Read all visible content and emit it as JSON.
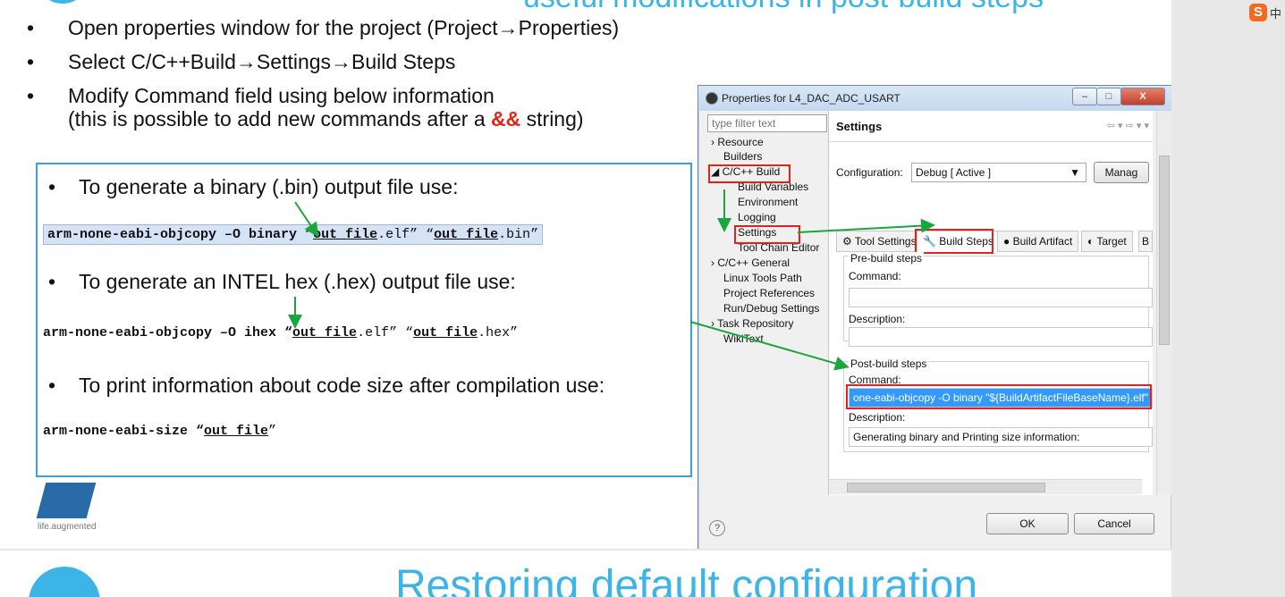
{
  "header": {
    "title_cut": "useful modifications in post-build steps"
  },
  "bullets": [
    {
      "text": "Open properties window for the project (Project→Properties)"
    },
    {
      "text": "Select C/C++Build→Settings→Build Steps"
    },
    {
      "text_line1": "Modify Command field using below information",
      "text_line2_pre": "(this is possible to add new commands after a ",
      "amp": "&&",
      "text_line2_post": " string)"
    }
  ],
  "codebox": {
    "item1": "To generate a binary (.bin) output file use:",
    "code1": {
      "a": "arm-none-eabi-objcopy –O binary “",
      "b": "out_file",
      "c": ".elf” “",
      "d": "out_file",
      "e": ".bin”"
    },
    "item2": "To generate an INTEL hex (.hex) output file use:",
    "code2": {
      "a": "arm-none-eabi-objcopy –O ihex “",
      "b": "out_file",
      "c": ".elf” “",
      "d": "out_file",
      "e": ".hex”"
    },
    "item3": "To print information about code size after compilation use:",
    "code3": {
      "a": "arm-none-eabi-size “",
      "b": "out_file",
      "c": "”"
    }
  },
  "logo": {
    "tagline": "life.augmented"
  },
  "window": {
    "title": "Properties for L4_DAC_ADC_USART",
    "controls": {
      "minimize": "–",
      "maximize": "□",
      "close": "X"
    },
    "filter_placeholder": "type filter text",
    "tree": [
      "› Resource",
      "Builders",
      "◢ C/C++ Build",
      "Build Variables",
      "Environment",
      "Logging",
      "Settings",
      "Tool Chain Editor",
      "› C/C++ General",
      "Linux Tools Path",
      "Project References",
      "Run/Debug Settings",
      "› Task Repository",
      "WikiText"
    ],
    "panel": {
      "title": "Settings",
      "nav": "⇦ ▾ ⇨ ▾ ▾",
      "config_label": "Configuration:",
      "config_value": "Debug  [ Active ]",
      "manage": "Manag",
      "tabs": [
        "Tool Settings",
        "Build Steps",
        "Build Artifact",
        "Target",
        "B"
      ],
      "pre_build": "Pre-build steps",
      "command": "Command:",
      "description": "Description:",
      "post_build": "Post-build steps",
      "post_command_value": "one-eabi-objcopy -O binary \"${BuildArtifactFileBaseName}.elf\" \"$",
      "post_description_value": "Generating binary and Printing size information:"
    },
    "ok": "OK",
    "cancel": "Cancel",
    "help": "?"
  },
  "tray": {
    "s": "S",
    "z": "中"
  },
  "next_slide": {
    "title": "Restoring default configuration"
  }
}
